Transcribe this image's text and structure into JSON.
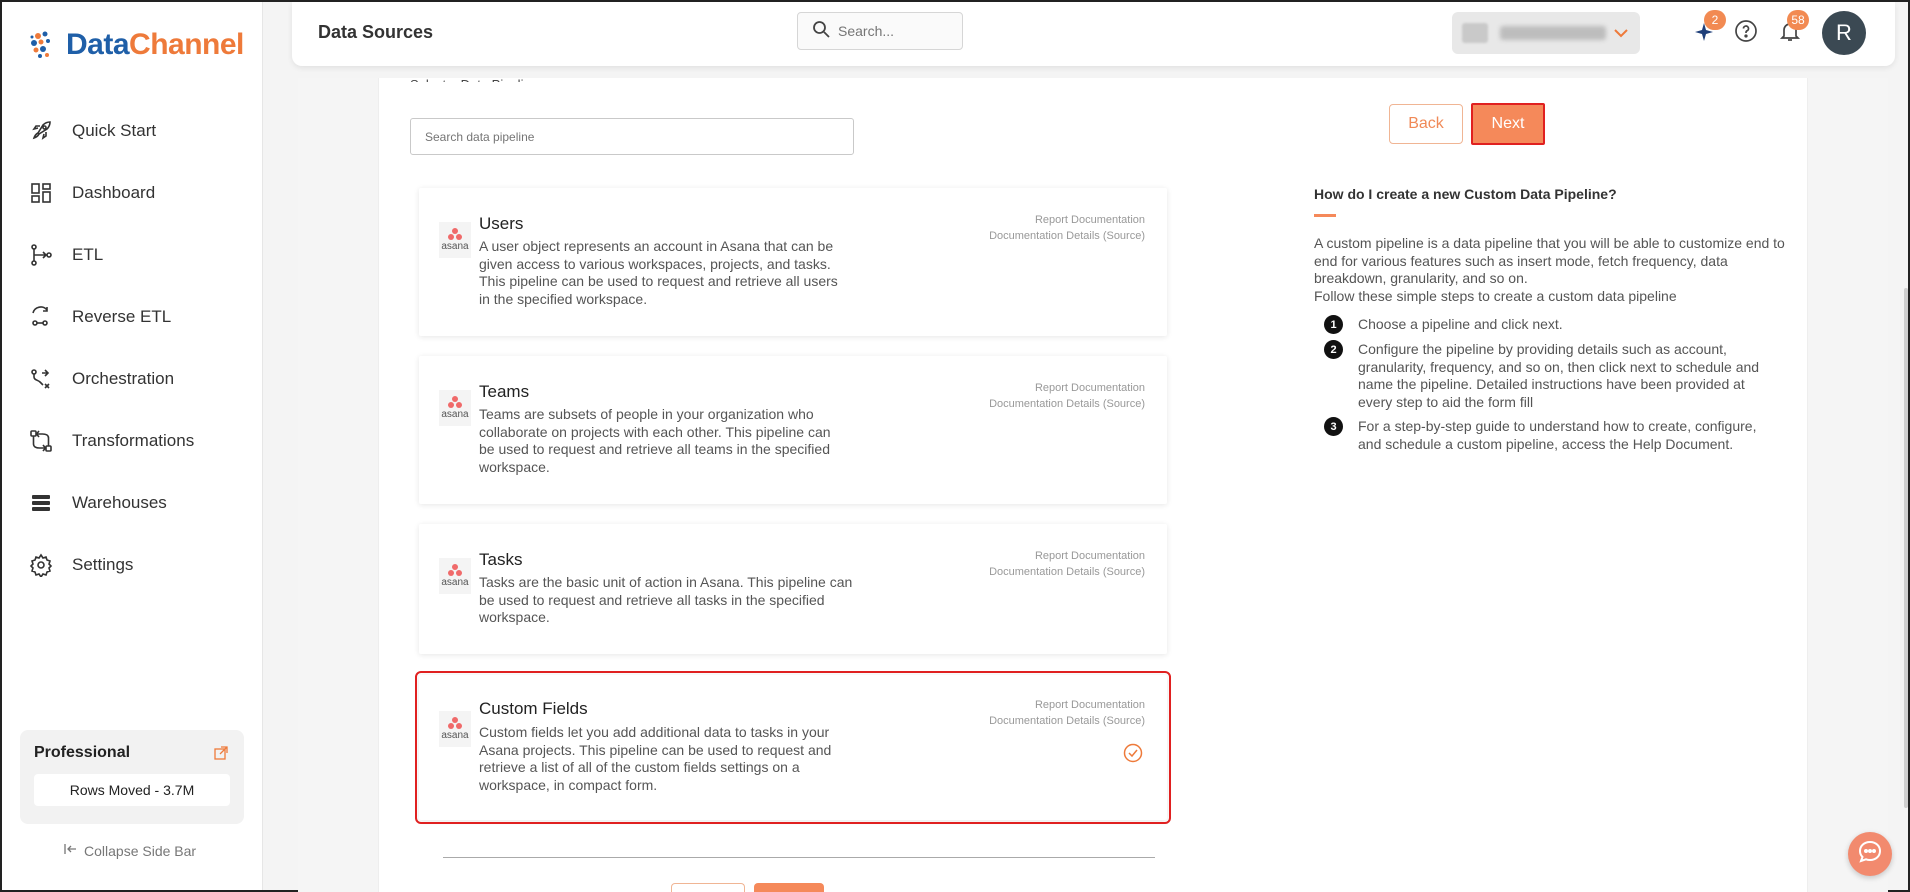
{
  "brand": {
    "name_part1": "Data",
    "name_part2": "Channel",
    "primary": "#1f5fa8",
    "accent": "#ee7a3a"
  },
  "sidebar": {
    "items": [
      {
        "label": "Quick Start",
        "icon": "rocket-icon"
      },
      {
        "label": "Dashboard",
        "icon": "dashboard-icon"
      },
      {
        "label": "ETL",
        "icon": "etl-icon"
      },
      {
        "label": "Reverse ETL",
        "icon": "reverse-etl-icon"
      },
      {
        "label": "Orchestration",
        "icon": "orchestration-icon"
      },
      {
        "label": "Transformations",
        "icon": "transformations-icon"
      },
      {
        "label": "Warehouses",
        "icon": "warehouses-icon"
      },
      {
        "label": "Settings",
        "icon": "gear-icon"
      }
    ],
    "plan": {
      "title": "Professional",
      "rows_moved": "Rows Moved - 3.7M"
    },
    "collapse_label": "Collapse Side Bar"
  },
  "header": {
    "title": "Data Sources",
    "search_placeholder": "Search...",
    "sparkle_badge": "2",
    "notification_badge": "58",
    "avatar_initial": "R"
  },
  "main": {
    "section_label": "Select a Data Pipeline",
    "pipeline_search_placeholder": "Search data pipeline",
    "back_label": "Back",
    "next_label": "Next",
    "cards": [
      {
        "title": "Users",
        "logo_text": "asana",
        "description": "A user object represents an account in Asana that can be given access to various workspaces, projects, and tasks. This pipeline can be used to request and retrieve all users in the specified workspace.",
        "link1": "Report Documentation",
        "link2": "Documentation Details (Source)"
      },
      {
        "title": "Teams",
        "logo_text": "asana",
        "description": "Teams are subsets of people in your organization who collaborate on projects with each other. This pipeline can be used to request and retrieve all teams in the specified workspace.",
        "link1": "Report Documentation",
        "link2": "Documentation Details (Source)"
      },
      {
        "title": "Tasks",
        "logo_text": "asana",
        "description": "Tasks are the basic unit of action in Asana. This pipeline can be used to request and retrieve all tasks in the specified workspace.",
        "link1": "Report Documentation",
        "link2": "Documentation Details (Source)"
      },
      {
        "title": "Custom Fields",
        "logo_text": "asana",
        "description": "Custom fields let you add additional data to tasks in your Asana projects. This pipeline can be used to request and retrieve a list of all of the custom fields settings on a workspace, in compact form.",
        "link1": "Report Documentation",
        "link2": "Documentation Details (Source)",
        "selected": true
      }
    ],
    "help": {
      "title": "How do I create a new Custom Data Pipeline?",
      "intro": "A custom pipeline is a data pipeline that you will be able to customize end to end for various features such as insert mode, fetch frequency, data breakdown, granularity, and so on.",
      "intro2": "Follow these simple steps to create a custom data pipeline",
      "steps": [
        {
          "num": "1",
          "text": "Choose a pipeline and click next."
        },
        {
          "num": "2",
          "text": "Configure the pipeline by providing details such as account, granularity, frequency, and so on, then click next to schedule and name the pipeline. Detailed instructions have been provided at every step to aid the form fill"
        },
        {
          "num": "3",
          "text": "For a step-by-step guide to understand how to create, configure, and schedule a custom pipeline, access the Help Document."
        }
      ]
    }
  }
}
